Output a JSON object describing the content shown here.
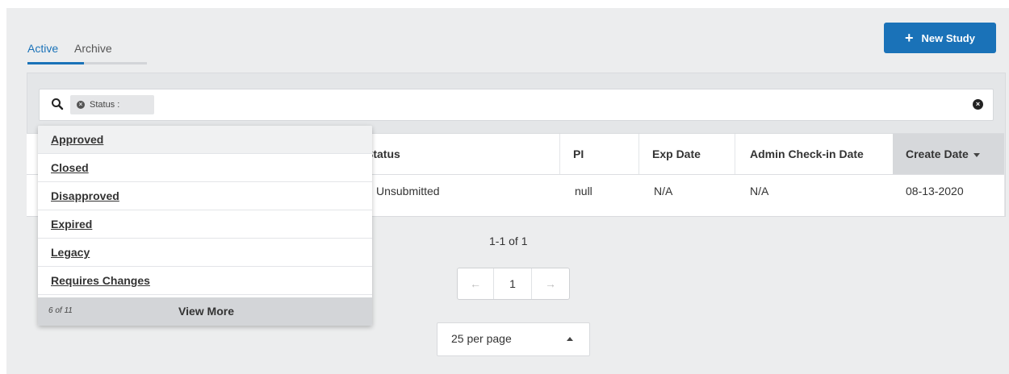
{
  "tabs": [
    {
      "label": "Active"
    },
    {
      "label": "Archive"
    }
  ],
  "new_study_button": {
    "label": "New Study"
  },
  "search": {
    "chip_label": "Status :"
  },
  "table": {
    "headers": [
      "Status",
      "PI",
      "Exp Date",
      "Admin Check-in Date",
      "Create Date"
    ],
    "row": [
      "Unsubmitted",
      "null",
      "N/A",
      "N/A",
      "08-13-2020"
    ]
  },
  "pagination": {
    "range_text": "1-1 of 1",
    "prev": "←",
    "page": "1",
    "next": "→"
  },
  "per_page": {
    "value": "25 per page"
  },
  "status_dropdown": {
    "options": [
      "Approved",
      "Closed",
      "Disapproved",
      "Expired",
      "Legacy",
      "Requires Changes"
    ],
    "count_text": "6 of 11",
    "view_more": "View More"
  }
}
